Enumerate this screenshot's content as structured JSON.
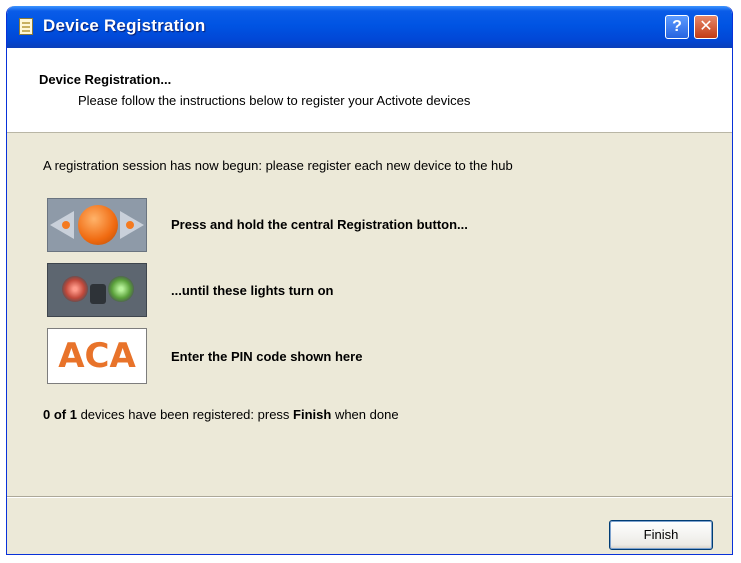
{
  "window": {
    "title": "Device Registration",
    "help_glyph": "?",
    "close_glyph": "✕"
  },
  "header": {
    "title": "Device Registration...",
    "subtitle": "Please follow the instructions below to register your Activote devices"
  },
  "body": {
    "intro": "A registration session has now begun: please register each new device to the hub",
    "steps": [
      {
        "text": "Press and hold the central Registration button...",
        "icon": "registration-button-image"
      },
      {
        "text": "...until these lights turn on",
        "icon": "device-lights-image"
      },
      {
        "text": "Enter the PIN code shown here",
        "icon": "pin-code-image",
        "pin": "ACA"
      }
    ],
    "status": {
      "count": "0 of 1",
      "middle": " devices have been registered: press ",
      "finish_word": "Finish",
      "end": " when done"
    }
  },
  "footer": {
    "finish_label": "Finish"
  },
  "colors": {
    "titlebar": "#0054e3",
    "window_bg": "#ece9d8",
    "pin_text": "#e8732a"
  }
}
